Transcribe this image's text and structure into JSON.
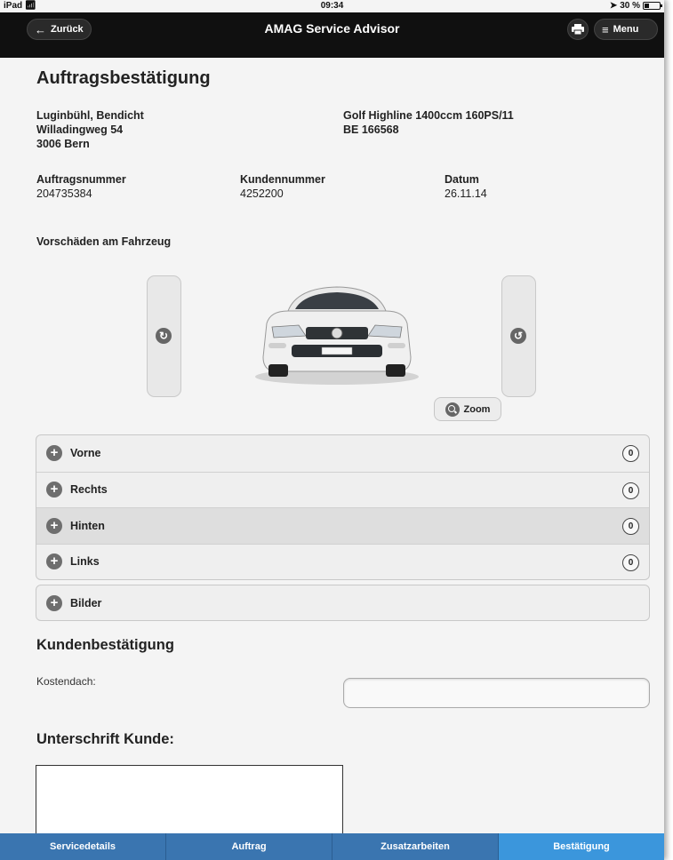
{
  "status": {
    "device": "iPad",
    "time": "09:34",
    "battery": "30 %"
  },
  "nav": {
    "back_label": "Zurück",
    "title": "AMAG Service Advisor",
    "menu_label": "Menu"
  },
  "page": {
    "title": "Auftragsbestätigung"
  },
  "customer": {
    "name": "Luginbühl, Bendicht",
    "street": "Willadingweg 54",
    "city": "3006 Bern"
  },
  "vehicle": {
    "model": "Golf Highline 1400ccm 160PS/11",
    "plate": "BE 166568"
  },
  "order": {
    "order_number_label": "Auftragsnummer",
    "order_number": "204735384",
    "customer_number_label": "Kundennummer",
    "customer_number": "4252200",
    "date_label": "Datum",
    "date": "26.11.14"
  },
  "damages": {
    "title": "Vorschäden am Fahrzeug",
    "zoom_label": "Zoom",
    "sections": [
      {
        "label": "Vorne",
        "count": "0"
      },
      {
        "label": "Rechts",
        "count": "0"
      },
      {
        "label": "Hinten",
        "count": "0"
      },
      {
        "label": "Links",
        "count": "0"
      }
    ],
    "images_label": "Bilder"
  },
  "confirmation": {
    "title": "Kundenbestätigung",
    "cost_cap_label": "Kostendach:",
    "cost_cap_value": "",
    "signature_label": "Unterschrift Kunde:"
  },
  "tabs": [
    {
      "label": "Servicedetails"
    },
    {
      "label": "Auftrag"
    },
    {
      "label": "Zusatzarbeiten"
    },
    {
      "label": "Bestätigung"
    }
  ],
  "colors": {
    "tab_bar": "#3a75b0",
    "tab_active": "#3b96dc",
    "nav_bar": "#101010"
  }
}
